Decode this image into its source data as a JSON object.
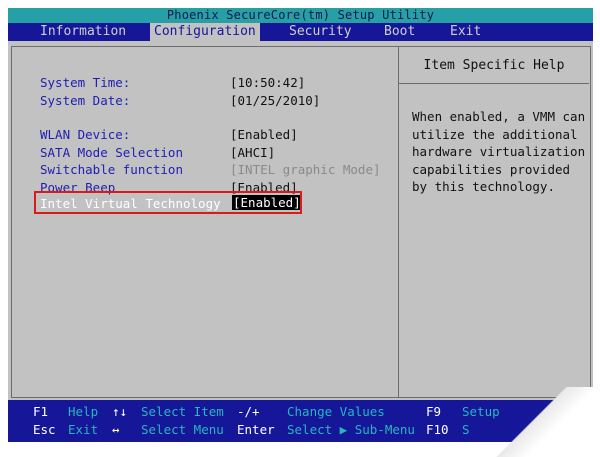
{
  "title": "Phoenix SecureCore(tm) Setup Utility",
  "menu": [
    {
      "label": "Information",
      "active": false
    },
    {
      "label": "Configuration",
      "active": true
    },
    {
      "label": "Security",
      "active": false
    },
    {
      "label": "Boot",
      "active": false
    },
    {
      "label": "Exit",
      "active": false
    }
  ],
  "settings": {
    "system_time": {
      "label": "System Time:",
      "value": "[10:50:42]"
    },
    "system_date": {
      "label": "System Date:",
      "value": "[01/25/2010]"
    },
    "wlan_device": {
      "label": "WLAN Device:",
      "value": "[Enabled]"
    },
    "sata_mode": {
      "label": "SATA Mode Selection",
      "value": "[AHCI]"
    },
    "switchable": {
      "label": "Switchable function",
      "value": "[INTEL graphic Mode]"
    },
    "power_beep": {
      "label": "Power Beep",
      "value": "[Enabled]"
    },
    "intel_vt": {
      "label": "Intel Virtual Technology",
      "value": "[Enabled]"
    }
  },
  "help": {
    "title": "Item Specific Help",
    "lines": [
      "When enabled, a VMM can",
      "utilize the additional",
      "hardware virtualization",
      "capabilities provided",
      "by this technology."
    ]
  },
  "footer": {
    "row1": {
      "f1": "F1",
      "help": "Help",
      "updown": "↑↓",
      "select_item": "Select Item",
      "minusplus": "-/+",
      "change_values": "Change Values",
      "f9": "F9",
      "setup": "Setup"
    },
    "row2": {
      "esc": "Esc",
      "exit": "Exit",
      "leftright": "↔",
      "select_menu": "Select Menu",
      "enter": "Enter",
      "select_submenu": "Select ▶ Sub-Menu",
      "f10": "F10",
      "save": "S"
    }
  },
  "colors": {
    "menubar": "#161699",
    "titlebar": "#26a0a6",
    "panel": "#c2c2c2",
    "highlight_border": "#d81b1b"
  }
}
